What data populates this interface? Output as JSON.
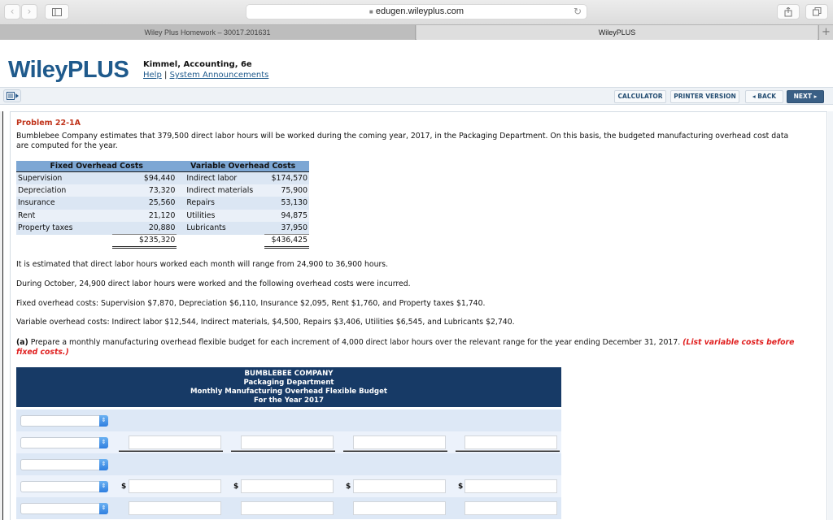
{
  "browser": {
    "url": "edugen.wileyplus.com",
    "tabs": [
      {
        "label": "Wiley Plus Homework – 30017.201631"
      },
      {
        "label": "WileyPLUS"
      }
    ],
    "icons": {
      "back": "‹",
      "forward": "›",
      "sidebar": "sidebar-icon",
      "lock": "🔒",
      "reload": "↻",
      "share": "share-icon",
      "tabs": "tabs-icon",
      "new_tab": "+"
    }
  },
  "header": {
    "logo": "WileyPLUS",
    "course": "Kimmel, Accounting, 6e",
    "help_link": "Help",
    "separator": "|",
    "announcements_link": "System Announcements"
  },
  "toolbar": {
    "calculator": "CALCULATOR",
    "printer_version": "PRINTER VERSION",
    "back": "◂ BACK",
    "next": "NEXT ▸"
  },
  "problem": {
    "title": "Problem 22-1A",
    "intro_line1": "Bumblebee Company estimates that 379,500 direct labor hours will be worked during the coming year, 2017, in the Packaging Department. On this basis, the budgeted manufacturing overhead cost data",
    "intro_line2": "are computed for the year.",
    "cost_table": {
      "fixed_header": "Fixed Overhead Costs",
      "variable_header": "Variable Overhead Costs",
      "rows": [
        {
          "fixed_name": "Supervision",
          "fixed_value": "$94,440",
          "var_name": "Indirect labor",
          "var_value": "$174,570"
        },
        {
          "fixed_name": "Depreciation",
          "fixed_value": "73,320",
          "var_name": "Indirect materials",
          "var_value": "75,900"
        },
        {
          "fixed_name": "Insurance",
          "fixed_value": "25,560",
          "var_name": "Repairs",
          "var_value": "53,130"
        },
        {
          "fixed_name": "Rent",
          "fixed_value": "21,120",
          "var_name": "Utilities",
          "var_value": "94,875"
        },
        {
          "fixed_name": "Property taxes",
          "fixed_value": "20,880",
          "var_name": "Lubricants",
          "var_value": "37,950"
        }
      ],
      "fixed_total": "$235,320",
      "variable_total": "$436,425"
    },
    "para_range": "It is estimated that direct labor hours worked each month will range from 24,900 to 36,900 hours.",
    "para_october": "During October, 24,900 direct labor hours were worked and the following overhead costs were incurred.",
    "para_fixed": "Fixed overhead costs: Supervision $7,870, Depreciation $6,110, Insurance $2,095, Rent $1,760, and Property taxes $1,740.",
    "para_variable": "Variable overhead costs: Indirect labor $12,544, Indirect materials, $4,500, Repairs $3,406, Utilities $6,545, and Lubricants $2,740.",
    "question_label": "(a)",
    "question_text": " Prepare a monthly manufacturing overhead flexible budget for each increment of 4,000 direct labor hours over the relevant range for the year ending December 31, 2017. ",
    "question_note": "(List variable costs before fixed costs.)"
  },
  "budget": {
    "line1": "BUMBLEBEE COMPANY",
    "line2": "Packaging Department",
    "line3": "Monthly Manufacturing Overhead Flexible Budget",
    "line4": "For the Year 2017",
    "currency_symbol": "$",
    "rows": [
      {
        "select_value": "",
        "inputs": []
      },
      {
        "select_value": "",
        "inputs": [
          "",
          "",
          "",
          ""
        ]
      },
      {
        "select_value": "",
        "inputs": []
      },
      {
        "select_value": "",
        "inputs": [
          "",
          "",
          "",
          ""
        ]
      },
      {
        "select_value": "",
        "inputs": [
          "",
          "",
          "",
          ""
        ]
      }
    ]
  }
}
